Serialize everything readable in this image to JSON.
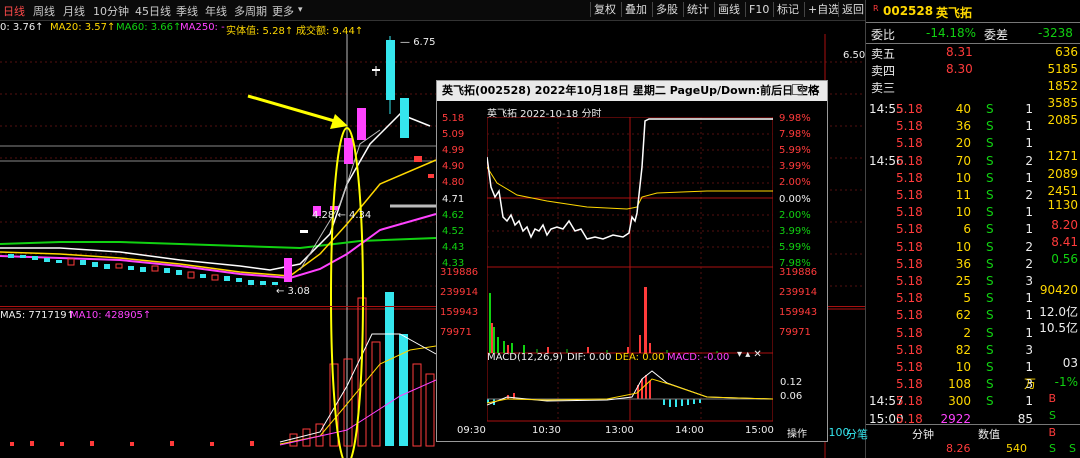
{
  "toolbar": {
    "tabs": [
      "日线",
      "周线",
      "月线",
      "10分钟",
      "45日线",
      "季线",
      "年线",
      "多周期",
      "更多"
    ],
    "active_tab": 0,
    "buttons": [
      "复权",
      "叠加",
      "多股",
      "统计",
      "画线",
      "F10",
      "标记",
      "+自选",
      "返回"
    ]
  },
  "ma_top": {
    "ma5": "0: 3.76↑",
    "ma20": "MA20: 3.57↑",
    "ma60": "MA60: 3.66↑",
    "ma250": "MA250: -",
    "body_value": "实体值: 5.28↑",
    "turnover": "成交额: 9.44↑"
  },
  "ma_vol": {
    "ma5": "MA5: 771719↑",
    "ma10": "MA10: 428905↑"
  },
  "main_chart": {
    "price_high": "6.75",
    "price_axis": "6.50",
    "label_low": "← 3.08",
    "label_mid": "4.28 ← 4.34"
  },
  "colors": {
    "up": "#ff3b3b",
    "down": "#33e2ee",
    "ma5": "#ffffff",
    "ma10": "#ffd800",
    "ma20": "#ff42ff",
    "ma60": "#11d111",
    "highlight": "#ffff00"
  },
  "quote": {
    "code": "002528",
    "name": "英飞拓",
    "r_badge": "R",
    "weibi_label": "委比",
    "weibi_value": "-14.18%",
    "weicha_label": "委差",
    "weicha_value": "-3238",
    "asks": [
      {
        "label": "卖五",
        "price": "8.31",
        "vol": "636"
      },
      {
        "label": "卖四",
        "price": "8.30",
        "vol": "5185"
      },
      {
        "label": "卖三",
        "price": "",
        "vol": "1852"
      }
    ],
    "right_col": [
      "1852",
      "3585",
      "2085",
      "1271",
      "2089",
      "2451",
      "1130",
      "8.20",
      "8.41",
      "0.56",
      "90420",
      "12.0亿",
      "10.5亿"
    ],
    "right_col_misc": [
      "03",
      "万",
      "-1%"
    ],
    "ticks": [
      {
        "time": "14:55",
        "price": "5.18",
        "vol": "40",
        "bs": "S",
        "n": "1"
      },
      {
        "time": "",
        "price": "5.18",
        "vol": "36",
        "bs": "S",
        "n": "1"
      },
      {
        "time": "",
        "price": "5.18",
        "vol": "20",
        "bs": "S",
        "n": "1"
      },
      {
        "time": "14:56",
        "price": "5.18",
        "vol": "70",
        "bs": "S",
        "n": "2"
      },
      {
        "time": "",
        "price": "5.18",
        "vol": "10",
        "bs": "S",
        "n": "1"
      },
      {
        "time": "",
        "price": "5.18",
        "vol": "11",
        "bs": "S",
        "n": "2"
      },
      {
        "time": "",
        "price": "5.18",
        "vol": "10",
        "bs": "S",
        "n": "1"
      },
      {
        "time": "",
        "price": "5.18",
        "vol": "6",
        "bs": "S",
        "n": "1"
      },
      {
        "time": "",
        "price": "5.18",
        "vol": "10",
        "bs": "S",
        "n": "2"
      },
      {
        "time": "",
        "price": "5.18",
        "vol": "36",
        "bs": "S",
        "n": "2"
      },
      {
        "time": "",
        "price": "5.18",
        "vol": "25",
        "bs": "S",
        "n": "3"
      },
      {
        "time": "",
        "price": "5.18",
        "vol": "5",
        "bs": "S",
        "n": "1"
      },
      {
        "time": "",
        "price": "5.18",
        "vol": "62",
        "bs": "S",
        "n": "1"
      },
      {
        "time": "",
        "price": "5.18",
        "vol": "2",
        "bs": "S",
        "n": "1"
      },
      {
        "time": "",
        "price": "5.18",
        "vol": "82",
        "bs": "S",
        "n": "3"
      },
      {
        "time": "",
        "price": "5.18",
        "vol": "10",
        "bs": "S",
        "n": "1"
      },
      {
        "time": "",
        "price": "5.18",
        "vol": "108",
        "bs": "S",
        "n": "3"
      },
      {
        "time": "14:57",
        "price": "5.18",
        "vol": "300",
        "bs": "S",
        "n": "1"
      },
      {
        "time": "15:00",
        "price": "5.18",
        "vol": "2922",
        "bs": "",
        "n": "85"
      }
    ],
    "bottom_tabs": [
      "分笔",
      "分钟",
      "数值"
    ],
    "bottom_left": "X100",
    "bottom_price": "8.26",
    "bottom_vol": "540",
    "bottom_right_badges": [
      "B",
      "S",
      "B",
      "S",
      "S"
    ]
  },
  "popup": {
    "title": "英飞拓(002528)  2022年10月18日 星期二  PageUp/Down:前后日  空格键:操作",
    "subtitle": "英飞拓  2022-10-18 分时",
    "price_left": [
      "5.18",
      "5.09",
      "4.99",
      "4.90",
      "4.80",
      "4.71",
      "4.62",
      "4.52",
      "4.43",
      "4.33"
    ],
    "price_right": [
      "9.98%",
      "7.98%",
      "5.99%",
      "3.99%",
      "2.00%",
      "0.00%",
      "2.00%",
      "3.99%",
      "5.99%",
      "7.98%"
    ],
    "vol_left": [
      "319886",
      "239914",
      "159943",
      "79971"
    ],
    "vol_right": [
      "319886",
      "239914",
      "159943",
      "79971"
    ],
    "macd_label": "MACD(12,26,9)",
    "dif": "DIF: 0.00",
    "dea": "DEA: 0.00",
    "macd": "MACD: -0.00",
    "macd_ticks": [
      "0.12",
      "0.06"
    ],
    "times": [
      "09:30",
      "10:30",
      "13:00",
      "14:00",
      "15:00"
    ],
    "ops_label": "操作"
  }
}
